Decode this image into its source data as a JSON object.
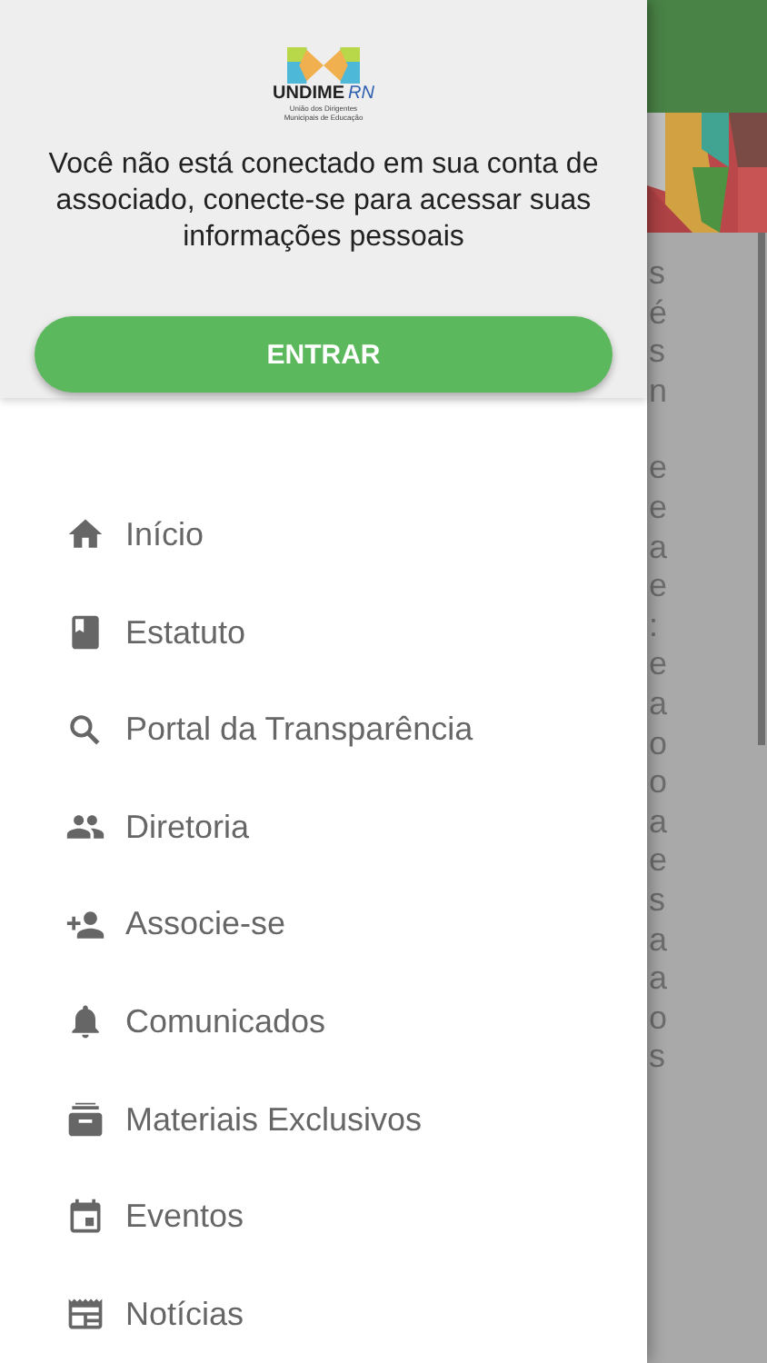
{
  "drawer": {
    "logo": {
      "wordmark": "UNDIME",
      "region": "RN",
      "caption": "União dos Dirigentes Municipais de Educação"
    },
    "message": "Você não está conectado em sua conta de associado, conecte-se para acessar suas informações pessoais",
    "login_button": "ENTRAR",
    "menu": [
      {
        "label": "Início"
      },
      {
        "label": "Estatuto"
      },
      {
        "label": "Portal da Transparência"
      },
      {
        "label": "Diretoria"
      },
      {
        "label": "Associe-se"
      },
      {
        "label": "Comunicados"
      },
      {
        "label": "Materiais Exclusivos"
      },
      {
        "label": "Eventos"
      },
      {
        "label": "Notícias"
      }
    ]
  },
  "background_page": {
    "paragraphs": [
      [
        "s",
        "é",
        "s",
        "n"
      ],
      [
        "e",
        "e",
        "a",
        "e",
        ":",
        "e",
        "a",
        "o",
        "o",
        "a",
        "e",
        "s",
        "a",
        "a",
        "o",
        "s"
      ]
    ]
  }
}
